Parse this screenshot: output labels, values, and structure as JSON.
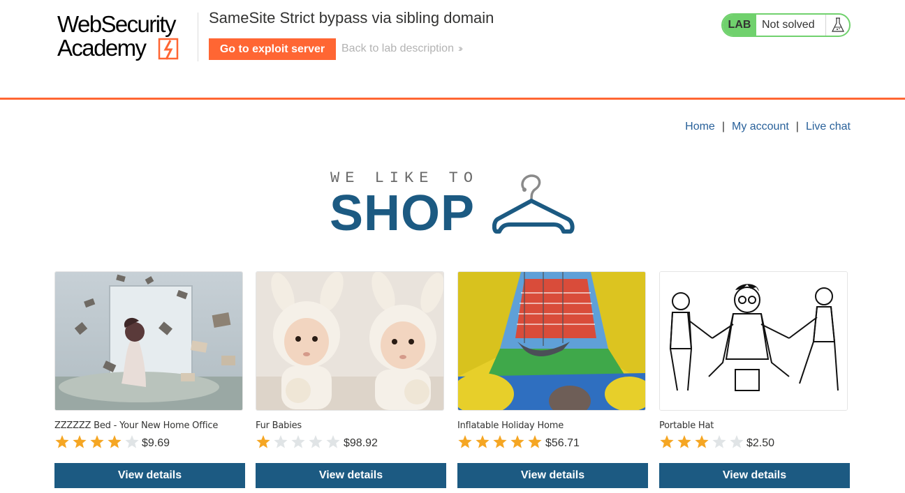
{
  "header": {
    "logo_line1": "WebSecurity",
    "logo_line2": "Academy",
    "lab_title": "SameSite Strict bypass via sibling domain",
    "exploit_button": "Go to exploit server",
    "back_link": "Back to lab description",
    "lab_badge": "LAB",
    "lab_status": "Not solved",
    "colors": {
      "accent": "#ff6633",
      "status_green": "#70d16d"
    }
  },
  "nav": {
    "links": [
      "Home",
      "My account",
      "Live chat"
    ],
    "separator": "|"
  },
  "banner": {
    "small_text": "WE LIKE TO",
    "big_text": "SHOP"
  },
  "products": [
    {
      "name": "ZZZZZZ Bed - Your New Home Office",
      "rating": 4,
      "max_rating": 5,
      "price": "$9.69",
      "button": "View details",
      "image": "woman-floating-books"
    },
    {
      "name": "Fur Babies",
      "rating": 1,
      "max_rating": 5,
      "price": "$98.92",
      "button": "View details",
      "image": "babies-in-bunny-hats"
    },
    {
      "name": "Inflatable Holiday Home",
      "rating": 5,
      "max_rating": 5,
      "price": "$56.71",
      "button": "View details",
      "image": "bouncy-castle-interior"
    },
    {
      "name": "Portable Hat",
      "rating": 3,
      "max_rating": 5,
      "price": "$2.50",
      "button": "View details",
      "image": "cartoon-men-pulling"
    }
  ],
  "colors": {
    "primary_blue": "#1c5a82",
    "link_blue": "#29619a",
    "star_gold": "#f5a623",
    "star_grey": "#e0e4e6"
  }
}
